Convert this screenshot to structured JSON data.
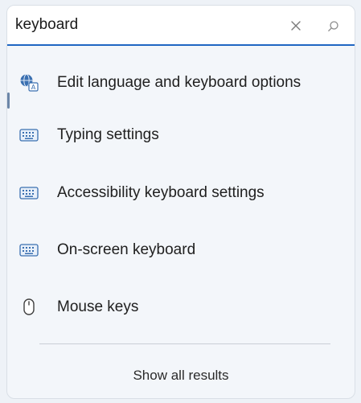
{
  "search": {
    "value": "keyboard",
    "placeholder": "",
    "clear_icon": "close-icon",
    "search_icon": "search-icon"
  },
  "results": [
    {
      "label": "Edit language and keyboard options",
      "icon": "language-icon"
    },
    {
      "label": "Typing settings",
      "icon": "keyboard-icon"
    },
    {
      "label": "Accessibility keyboard settings",
      "icon": "keyboard-icon"
    },
    {
      "label": "On-screen keyboard",
      "icon": "keyboard-icon"
    },
    {
      "label": "Mouse keys",
      "icon": "mouse-icon"
    }
  ],
  "footer": {
    "show_all_label": "Show all results"
  },
  "colors": {
    "accent": "#1f66c2",
    "icon_blue": "#3a6fb0"
  }
}
